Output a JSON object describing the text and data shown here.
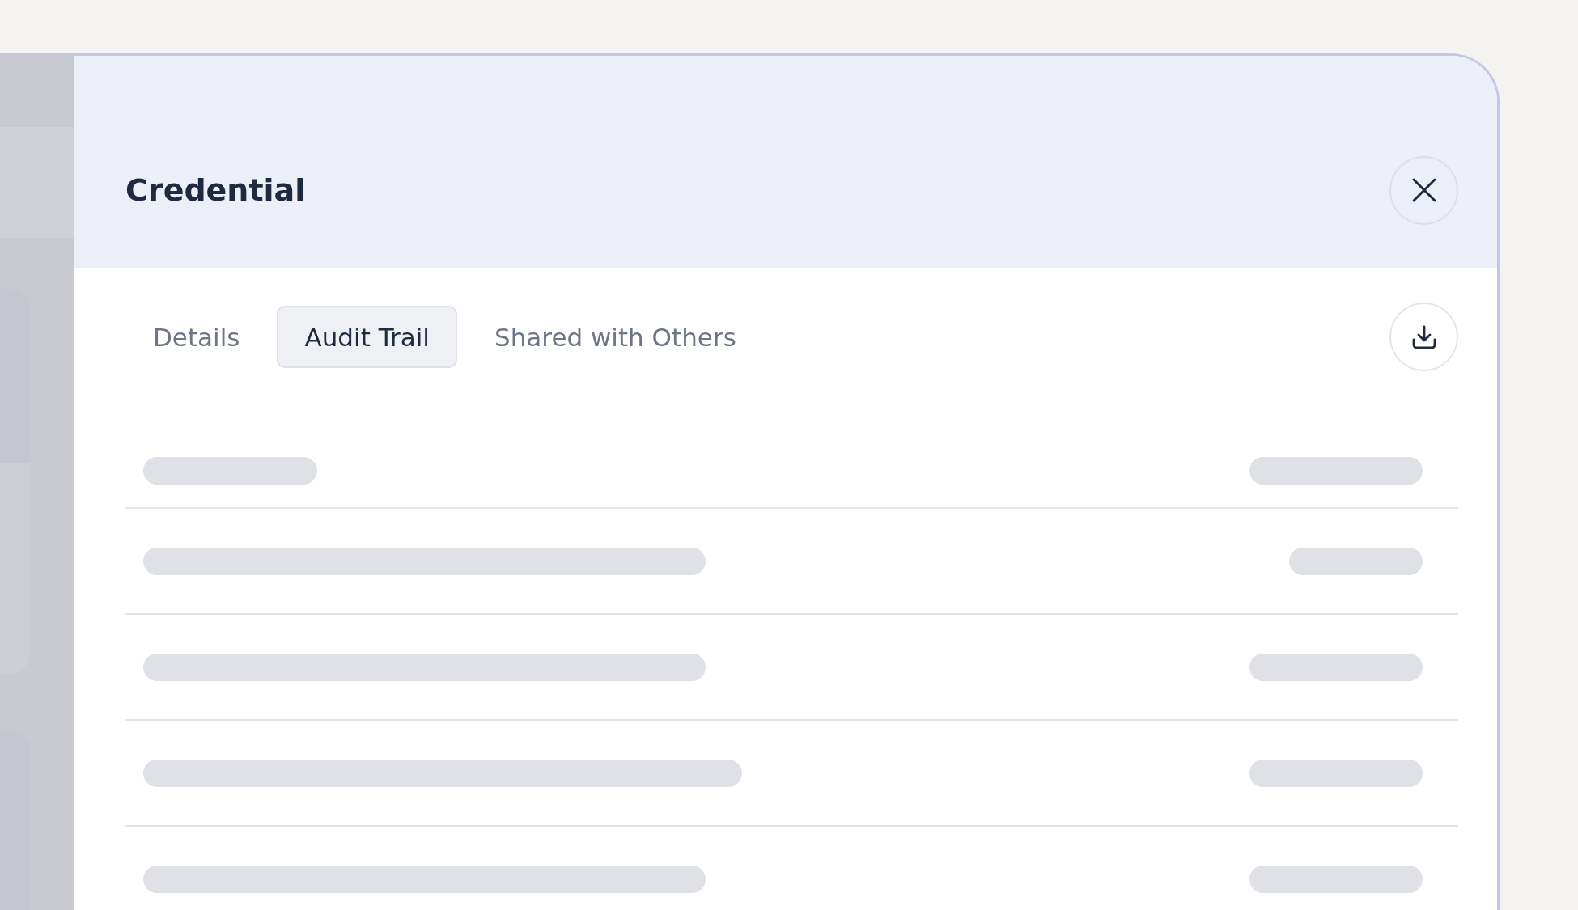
{
  "dialog": {
    "title": "Credential"
  },
  "tabs": [
    {
      "label": "Details",
      "selected": false
    },
    {
      "label": "Audit Trail",
      "selected": true
    },
    {
      "label": "Shared with Others",
      "selected": false
    }
  ],
  "audit_trail": {
    "rows": [
      {
        "kind": "loading"
      },
      {
        "kind": "loading"
      },
      {
        "kind": "loading"
      },
      {
        "kind": "loading"
      },
      {
        "kind": "loading"
      }
    ]
  }
}
